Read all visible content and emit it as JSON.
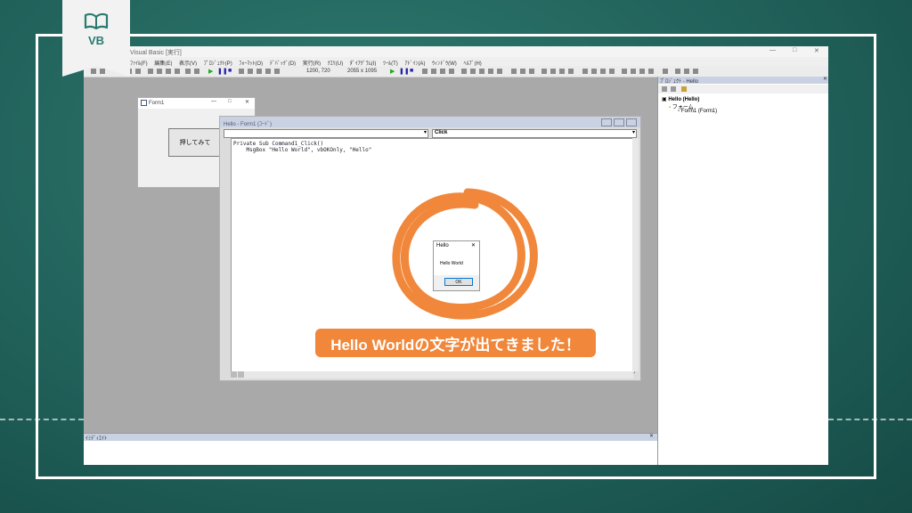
{
  "brand": {
    "tag": "VB",
    "accent": "#2a7a70"
  },
  "ide": {
    "title": "Visual Basic [実行]",
    "menu": [
      "ﾌｧｲﾙ(F)",
      "編集(E)",
      "表示(V)",
      "ﾌﾟﾛｼﾞｪｸﾄ(P)",
      "ﾌｫｰﾏｯﾄ(O)",
      "ﾃﾞﾊﾞｯｸﾞ(D)",
      "実行(R)",
      "ｸｴﾘ(U)",
      "ﾀﾞｲｱｸﾞﾗﾑ(I)",
      "ﾂｰﾙ(T)",
      "ｱﾄﾞｲﾝ(A)",
      "ｳｨﾝﾄﾞｳ(W)",
      "ﾍﾙﾌﾟ(H)"
    ],
    "position": "1200, 720",
    "size": "2055 x 1095"
  },
  "project": {
    "title": "ﾌﾟﾛｼﾞｪｸﾄ - Hello",
    "root": "Hello (Hello)",
    "folder": "フォーム",
    "form": "Form1 (Form1)"
  },
  "form1": {
    "title": "Form1",
    "button": "押してみて"
  },
  "code_window": {
    "title": "Hello - Form1 (ｺｰﾄﾞ)",
    "proc": "Click",
    "lines": [
      "Private Sub Command1_Click()",
      "    MsgBox \"Hello World\", vbOKOnly, \"Hello\""
    ]
  },
  "msgbox": {
    "title": "Hello",
    "message": "Hello World",
    "ok": "OK"
  },
  "immediate": {
    "title": "ｲﾐﾃﾞｨｴｲﾄ"
  },
  "caption": "Hello Worldの文字が出てきました！"
}
